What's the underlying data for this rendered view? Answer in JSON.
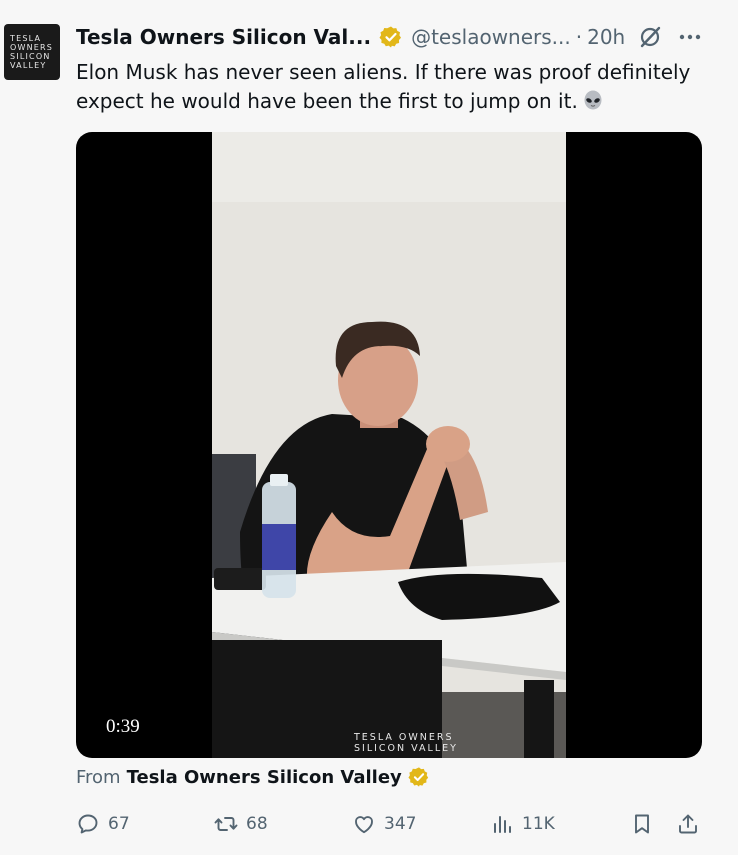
{
  "post": {
    "author": {
      "avatar_lines": [
        "TESLA",
        "OWNERS",
        "SILICON",
        "VALLEY"
      ],
      "display_name": "Tesla Owners Silicon Val...",
      "handle": "@teslaowners...",
      "separator": "·",
      "time_ago": "20h"
    },
    "text_lines": [
      "Elon Musk has never seen aliens. If there was proof definitely",
      "expect he would have been the first to jump on it."
    ],
    "media": {
      "duration": "0:39",
      "watermark_lines": [
        "TESLA OWNERS",
        "SILICON VALLEY"
      ]
    },
    "source": {
      "label": "From",
      "name": "Tesla Owners Silicon Valley"
    },
    "stats": {
      "replies": "67",
      "reposts": "68",
      "likes": "347",
      "views": "11K"
    }
  },
  "icons": {
    "verified": "verified-badge-gold",
    "grok": "grok-icon",
    "more": "more-dots-icon",
    "alien": "alien-emoji",
    "reply": "reply-icon",
    "repost": "repost-icon",
    "like": "heart-icon",
    "views": "views-bar-chart-icon",
    "bookmark": "bookmark-icon",
    "share": "share-icon"
  },
  "colors": {
    "text": "#0f1419",
    "secondary_text": "#536471",
    "verified_gold": "#e2b719",
    "background": "#f7f7f7",
    "media_bg": "#000000"
  }
}
